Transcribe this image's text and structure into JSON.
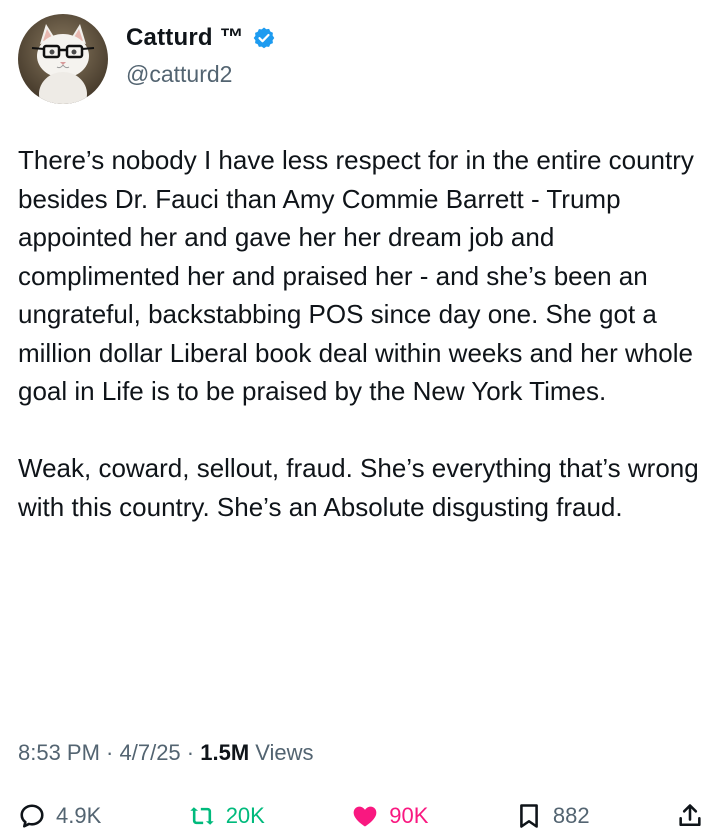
{
  "author": {
    "display_name": "Catturd ™",
    "handle": "@catturd2",
    "verified": true
  },
  "tweet": {
    "paragraphs": [
      "There’s nobody I have less respect for in the entire country besides Dr. Fauci than Amy Commie Barrett - Trump appointed her and gave her her dream job and complimented her and praised her - and she’s been an ungrateful, backstabbing POS since day one. She got a million dollar Liberal book deal within weeks and her whole goal in Life is to be praised by the New York Times.",
      "Weak, coward, sellout, fraud. She’s everything that’s wrong with this country. She’s an Absolute disgusting fraud."
    ],
    "time": "8:53 PM",
    "date": "4/7/25",
    "separator": " · ",
    "views_count": "1.5M",
    "views_label": " Views"
  },
  "actions": {
    "replies": "4.9K",
    "reposts": "20K",
    "likes": "90K",
    "bookmarks": "882"
  },
  "colors": {
    "verified": "#1d9bf0",
    "repost": "#00ba7c",
    "like": "#f91880",
    "muted": "#536471",
    "text": "#0f1419"
  },
  "icons": {
    "reply": "reply-icon",
    "repost": "repost-icon",
    "like": "heart-icon",
    "bookmark": "bookmark-icon",
    "share": "share-icon",
    "verified": "verified-badge-icon"
  }
}
